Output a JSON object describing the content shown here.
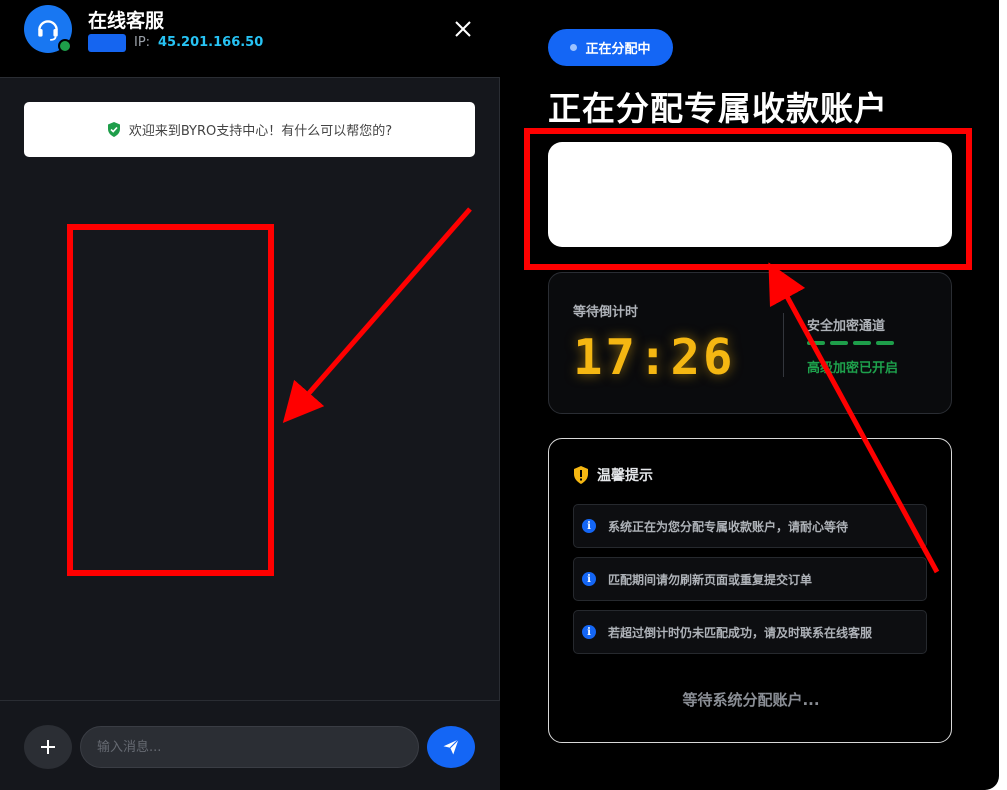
{
  "chat": {
    "title": "在线客服",
    "ip_label": "IP:",
    "ip_value": "45.201.166.50",
    "welcome": "欢迎来到BYRO支持中心！有什么可以帮您的?",
    "input_placeholder": "输入消息..."
  },
  "assign": {
    "badge": "正在分配中",
    "title": "正在分配专属收款账户",
    "countdown_label": "等待倒计时",
    "countdown_value": "17:26",
    "secure_label": "安全加密通道",
    "secure_status": "高级加密已开启",
    "tips_title": "温馨提示",
    "tips": [
      "系统正在为您分配专属收款账户，请耐心等待",
      "匹配期间请勿刷新页面或重复提交订单",
      "若超过倒计时仍未匹配成功，请及时联系在线客服"
    ],
    "waiting": "等待系统分配账户..."
  },
  "colors": {
    "accent_blue": "#1466f5",
    "timer_gold": "#f5b712",
    "secure_green": "#1ea14c",
    "annotation_red": "#ff0000"
  },
  "icons": [
    "headset-icon",
    "close-icon",
    "shield-check-icon",
    "plus-icon",
    "send-icon",
    "warning-shield-icon",
    "info-icon"
  ]
}
